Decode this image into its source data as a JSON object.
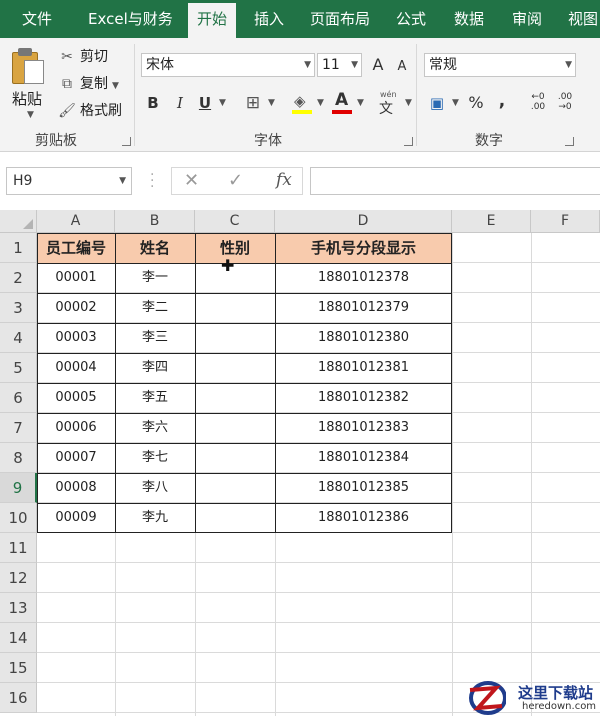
{
  "tabs": [
    "文件",
    "Excel与财务",
    "开始",
    "插入",
    "页面布局",
    "公式",
    "数据",
    "审阅",
    "视图"
  ],
  "active_tab": "开始",
  "ribbon": {
    "clipboard": {
      "paste_label": "粘贴",
      "cut_label": "剪切",
      "copy_label": "复制",
      "format_painter_label": "格式刷",
      "group_label": "剪贴板"
    },
    "font": {
      "font_name": "宋体",
      "font_size": "11",
      "grow_label": "A",
      "shrink_label": "A",
      "bold_label": "B",
      "italic_label": "I",
      "underline_label": "U",
      "font_color_label": "A",
      "phonetic_label": "文",
      "phonetic_top": "wén",
      "group_label": "字体",
      "highlight_color": "#ffff00",
      "font_color": "#e00000"
    },
    "number": {
      "format": "常规",
      "percent_label": "%",
      "comma_label": ",",
      "group_label": "数字"
    }
  },
  "formula_bar": {
    "name_box": "H9",
    "cancel_label": "✕",
    "enter_label": "✓",
    "fx_label": "fx",
    "formula": ""
  },
  "columns": [
    "A",
    "B",
    "C",
    "D",
    "E",
    "F"
  ],
  "rows": [
    "1",
    "2",
    "3",
    "4",
    "5",
    "6",
    "7",
    "8",
    "9",
    "10",
    "11",
    "12",
    "13",
    "14",
    "15",
    "16"
  ],
  "selected_row": "9",
  "table": {
    "headers": [
      "员工编号",
      "姓名",
      "性别",
      "手机号分段显示"
    ],
    "rows": [
      [
        "00001",
        "李一",
        "",
        "18801012378"
      ],
      [
        "00002",
        "李二",
        "",
        "18801012379"
      ],
      [
        "00003",
        "李三",
        "",
        "18801012380"
      ],
      [
        "00004",
        "李四",
        "",
        "18801012381"
      ],
      [
        "00005",
        "李五",
        "",
        "18801012382"
      ],
      [
        "00006",
        "李六",
        "",
        "18801012383"
      ],
      [
        "00007",
        "李七",
        "",
        "18801012384"
      ],
      [
        "00008",
        "李八",
        "",
        "18801012385"
      ],
      [
        "00009",
        "李九",
        "",
        "18801012386"
      ]
    ],
    "header_color": "#f8cbad"
  },
  "colors": {
    "accent": "#217346"
  },
  "watermark": {
    "title": "这里下载站",
    "site": "heredown.com"
  }
}
